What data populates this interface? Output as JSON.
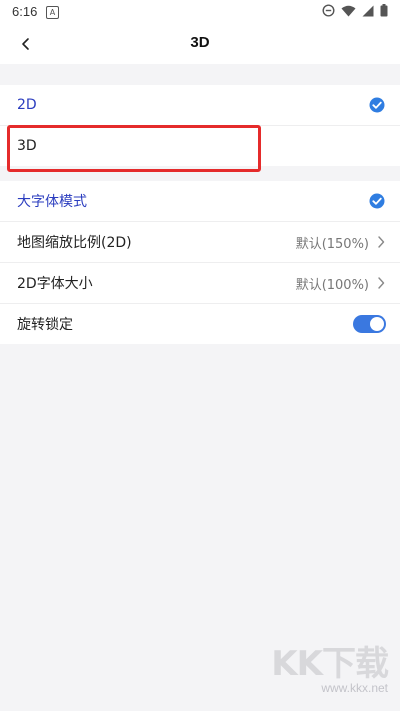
{
  "status_bar": {
    "time": "6:16",
    "notification_icon": "a-icon",
    "icons": [
      "dnd-icon",
      "wifi-icon",
      "signal-icon",
      "battery-icon"
    ]
  },
  "header": {
    "title": "3D",
    "back_icon": "chevron-left-icon"
  },
  "mode_group": {
    "items": [
      {
        "label": "2D",
        "selected": true
      },
      {
        "label": "3D",
        "selected": false
      }
    ]
  },
  "settings_group": {
    "items": [
      {
        "label": "大字体模式",
        "type": "check",
        "checked": true
      },
      {
        "label": "地图缩放比例(2D)",
        "value": "默认(150%)",
        "type": "link"
      },
      {
        "label": "2D字体大小",
        "value": "默认(100%)",
        "type": "link"
      },
      {
        "label": "旋转锁定",
        "type": "toggle",
        "on": true
      }
    ]
  },
  "colors": {
    "accent": "#2b3dbf",
    "check_blue": "#2f7de1",
    "toggle_on": "#3a78e0",
    "highlight_red": "#e52b2b"
  },
  "watermark": {
    "logo": "KK下载",
    "url": "www.kkx.net"
  }
}
